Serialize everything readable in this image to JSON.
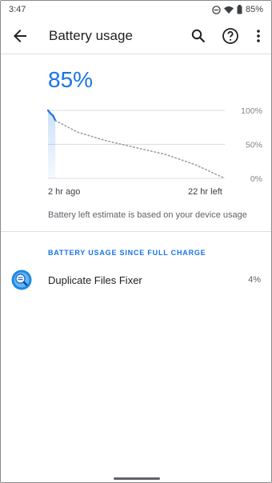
{
  "status_bar": {
    "time": "3:47",
    "battery": "85%"
  },
  "app_bar": {
    "title": "Battery usage"
  },
  "battery": {
    "percent": "85%",
    "level": 0.85
  },
  "chart_data": {
    "type": "line",
    "ytick_labels": [
      "100%",
      "50%",
      "0%"
    ],
    "ylim": [
      0,
      100
    ],
    "x_labels": {
      "left": "2 hr ago",
      "right": "22 hr left"
    },
    "history": {
      "x": [
        0,
        0.3,
        0.7,
        1.0
      ],
      "y": [
        100,
        96,
        92,
        85
      ]
    },
    "projection": {
      "x": [
        1.0,
        4,
        8,
        12,
        16,
        20,
        24
      ],
      "y": [
        85,
        68,
        55,
        45,
        35,
        20,
        0
      ]
    },
    "grid": true,
    "accent": "#1a73e8"
  },
  "estimate_note": "Battery left estimate is based on your device usage",
  "usage_section": {
    "header": "BATTERY USAGE SINCE FULL CHARGE",
    "apps": [
      {
        "name": "Duplicate Files Fixer",
        "percent": "4%",
        "icon": "duplicate-files-fixer-icon"
      }
    ]
  }
}
